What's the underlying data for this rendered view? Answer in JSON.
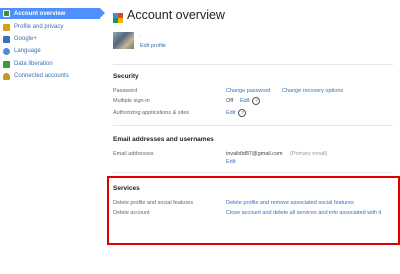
{
  "sidebar": {
    "items": [
      {
        "label": "Account overview",
        "icon": "account-icon",
        "color": "#4a8f2a",
        "active": true
      },
      {
        "label": "Profile and privacy",
        "icon": "profile-icon",
        "color": "#d69e1e"
      },
      {
        "label": "Google+",
        "icon": "google-plus-icon",
        "color": "#3b6fb6"
      },
      {
        "label": "Language",
        "icon": "language-icon",
        "color": "#4d8fd6"
      },
      {
        "label": "Data liberation",
        "icon": "data-liberation-icon",
        "color": "#3c9a3c"
      },
      {
        "label": "Connected accounts",
        "icon": "key-icon",
        "color": "#c49a2a"
      }
    ]
  },
  "header": {
    "title": "Account overview"
  },
  "profile": {
    "dot": ".",
    "edit_label": "Edit profile"
  },
  "security": {
    "title": "Security",
    "password_label": "Password",
    "change_password": "Change password",
    "change_recovery": "Change recovery options",
    "multiple_signin_label": "Multiple sign-in",
    "multiple_signin_value": "Off",
    "multiple_signin_edit": "Edit",
    "authorizing_label": "Authorizing applications & sites",
    "authorizing_edit": "Edit"
  },
  "email": {
    "title": "Email addresses and usernames",
    "addresses_label": "Email addresses",
    "address": "invalidid87@gmail.com",
    "primary_tag": "(Primary email)",
    "edit": "Edit"
  },
  "services": {
    "title": "Services",
    "delete_profile_label": "Delete profile and social features",
    "delete_profile_link": "Delete profile and remove associated social features",
    "delete_account_label": "Delete account",
    "delete_account_link": "Close account and delete all services and info associated with it"
  },
  "colors": {
    "accent": "#4d90fe",
    "link": "#3b6fb6",
    "highlight": "#e00000"
  }
}
